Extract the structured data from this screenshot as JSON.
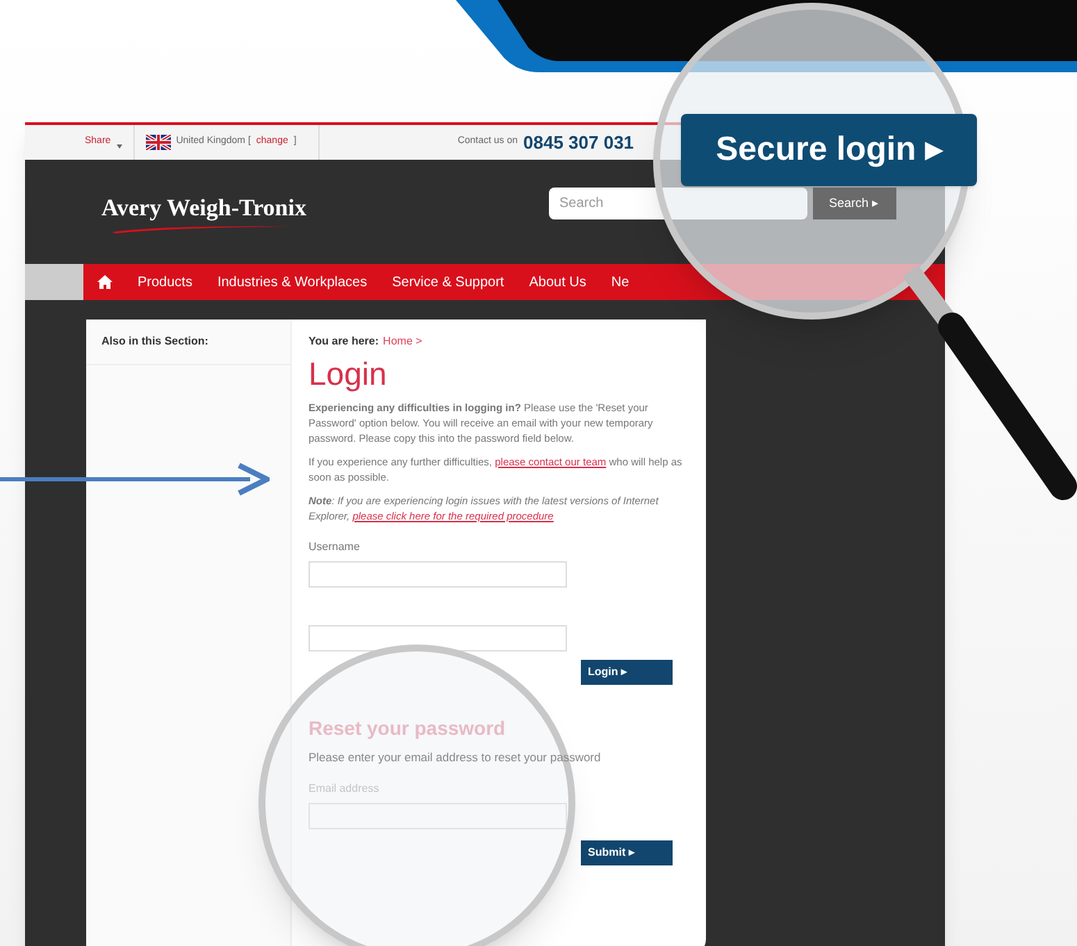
{
  "top_bar": {
    "share": "Share",
    "country": "United Kingdom [",
    "change_link": "change",
    "country_end": "]",
    "contact_label": "Contact us on",
    "phone": "0845 307 031"
  },
  "header": {
    "logo": "Avery Weigh-Tronix",
    "search": {
      "placeholder": "Search"
    },
    "search_button": "Search ▸"
  },
  "nav": [
    {
      "label": "Products"
    },
    {
      "label": "Industries & Workplaces"
    },
    {
      "label": "Service & Support"
    },
    {
      "label": "About Us"
    },
    {
      "label": "Ne"
    }
  ],
  "sidebar": {
    "title": "Also in this Section:"
  },
  "breadcrumb": {
    "label": "You are here:",
    "link": "Home >"
  },
  "title": "Login",
  "paragraphs": [
    {
      "kind": "plain",
      "text": "**Experiencing any difficulties in logging in?** Please use the 'Reset your Password' option below. You will receive an email with your new temporary password. Please copy this into the password field below."
    },
    {
      "kind": "link",
      "before": "If you experience any further difficulties, ",
      "link": "please contact our team",
      "after": " who will help as soon as possible."
    },
    {
      "kind": "note",
      "before": "**Note**: If you are experiencing login issues with the latest versions of Internet Explorer, ",
      "link": "please click here for the required procedure"
    }
  ],
  "login_form": {
    "username_label": "Username",
    "login_button": "Login ▸"
  },
  "reset": {
    "title": "Reset your password",
    "text": "Please enter your email address to reset your password",
    "email_label": "Email address",
    "submit_button": "Submit ▸"
  },
  "callout": {
    "button": "Secure login ▸"
  }
}
